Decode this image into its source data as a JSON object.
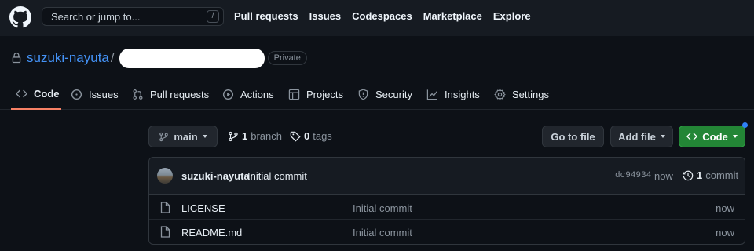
{
  "header": {
    "search_placeholder": "Search or jump to...",
    "search_shortcut": "/",
    "nav": [
      "Pull requests",
      "Issues",
      "Codespaces",
      "Marketplace",
      "Explore"
    ]
  },
  "repo": {
    "owner": "suzuki-nayuta",
    "separator": "/",
    "visibility": "Private"
  },
  "tabs": [
    {
      "label": "Code",
      "icon": "code-icon",
      "active": true
    },
    {
      "label": "Issues",
      "icon": "issue-icon"
    },
    {
      "label": "Pull requests",
      "icon": "pull-request-icon"
    },
    {
      "label": "Actions",
      "icon": "play-icon"
    },
    {
      "label": "Projects",
      "icon": "table-icon"
    },
    {
      "label": "Security",
      "icon": "shield-icon"
    },
    {
      "label": "Insights",
      "icon": "graph-icon"
    },
    {
      "label": "Settings",
      "icon": "gear-icon"
    }
  ],
  "toolbar": {
    "branch": "main",
    "branch_count": "1",
    "branch_label": "branch",
    "tag_count": "0",
    "tag_label": "tags",
    "goto_file": "Go to file",
    "add_file": "Add file",
    "code": "Code"
  },
  "latest_commit": {
    "author": "suzuki-nayuta",
    "message": "Initial commit",
    "sha": "dc94934",
    "age": "now",
    "commit_count": "1",
    "commit_label": "commit"
  },
  "files": [
    {
      "name": "LICENSE",
      "message": "Initial commit",
      "age": "now"
    },
    {
      "name": "README.md",
      "message": "Initial commit",
      "age": "now"
    }
  ],
  "colors": {
    "accent_link": "#4493f8",
    "active_tab_underline": "#f78166",
    "primary_button": "#238636",
    "notification_dot": "#2f81f7"
  }
}
